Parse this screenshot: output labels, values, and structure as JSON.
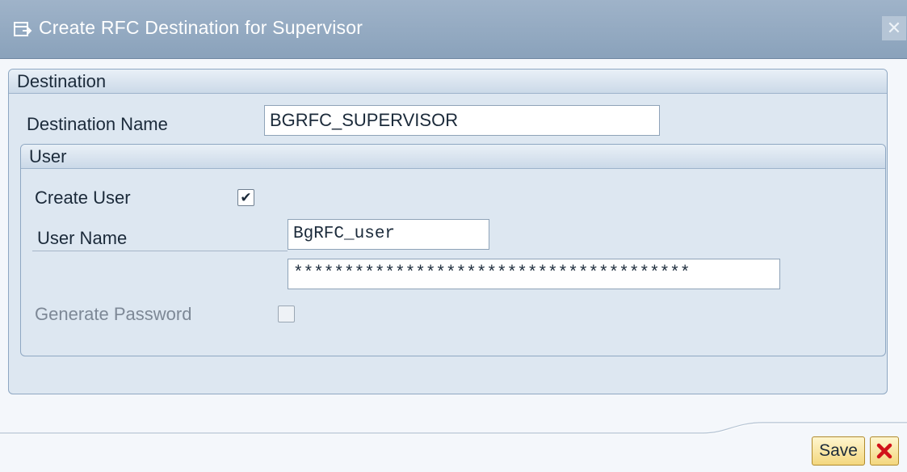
{
  "window": {
    "title": "Create RFC Destination for Supervisor"
  },
  "destination_group": {
    "header": "Destination",
    "destination_name_label": "Destination Name",
    "destination_name_value": "BGRFC_SUPERVISOR"
  },
  "user_group": {
    "header": "User",
    "create_user_label": "Create User",
    "create_user_checked": true,
    "user_name_label": "User Name",
    "user_name_value": "BgRFC_user",
    "password_value": "***************************************",
    "generate_password_label": "Generate Password",
    "generate_password_checked": false,
    "generate_password_enabled": false
  },
  "footer": {
    "save_label": "Save",
    "cancel_icon": "cancel-x-icon"
  },
  "icons": {
    "title_icon": "dialog-window-icon",
    "close_icon": "close-icon"
  },
  "colors": {
    "title_bar": "#8aa2bb",
    "panel": "#dde7f1",
    "button": "#f3d77e",
    "cancel_red": "#d1121a"
  }
}
